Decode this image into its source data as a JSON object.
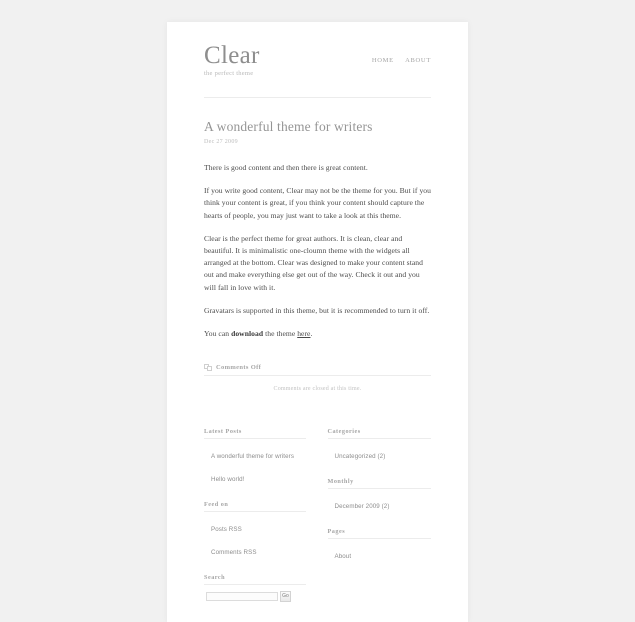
{
  "site": {
    "title": "Clear",
    "tagline": "the perfect theme",
    "nav": [
      {
        "label": "Home"
      },
      {
        "label": "About"
      }
    ]
  },
  "post": {
    "title": "A wonderful theme for writers",
    "date": "Dec 27 2009",
    "paragraphs": [
      "There is good content and then there is great content.",
      "If you write good content, Clear may not be the theme for you. But if you think your content is great, if you think your content should capture the hearts of people, you may just want to take a look at this theme.",
      "Clear is the perfect theme for great authors. It is clean, clear and beautiful. It is minimalistic one-cloumn theme with the widgets all arranged at the bottom. Clear was designed to make your content stand out and make everything else get out of the way. Check it out and you will fall in love with it.",
      "Gravatars is supported in this theme, but it is recommended to turn it off."
    ],
    "closing": {
      "before": "You can ",
      "bold": "download",
      "middle": " the theme ",
      "link": "here",
      "after": "."
    }
  },
  "comments": {
    "icon": "comment-bubbles-icon",
    "heading": "Comments Off",
    "note": "Comments are closed at this time."
  },
  "widgets": {
    "left": [
      {
        "title": "Latest Posts",
        "items": [
          {
            "label": "A wonderful theme for writers"
          },
          {
            "label": "Hello world!"
          }
        ]
      },
      {
        "title": "Feed on",
        "items": [
          {
            "label": "Posts RSS"
          },
          {
            "label": "Comments RSS"
          }
        ]
      }
    ],
    "right": [
      {
        "title": "Categories",
        "items": [
          {
            "label": "Uncategorized (2)"
          }
        ]
      },
      {
        "title": "Monthly",
        "items": [
          {
            "label": "December 2009 (2)"
          }
        ]
      },
      {
        "title": "Pages",
        "items": [
          {
            "label": "About"
          }
        ]
      }
    ]
  },
  "search": {
    "title": "Search",
    "value": "",
    "placeholder": "",
    "button_label": "Go"
  },
  "colors": {
    "page_background": "#f1f1f1",
    "card_background": "#ffffff",
    "heading": "#959595",
    "body_text": "#4a4a4a",
    "muted": "#bdbdbd",
    "rule": "#ececec"
  }
}
